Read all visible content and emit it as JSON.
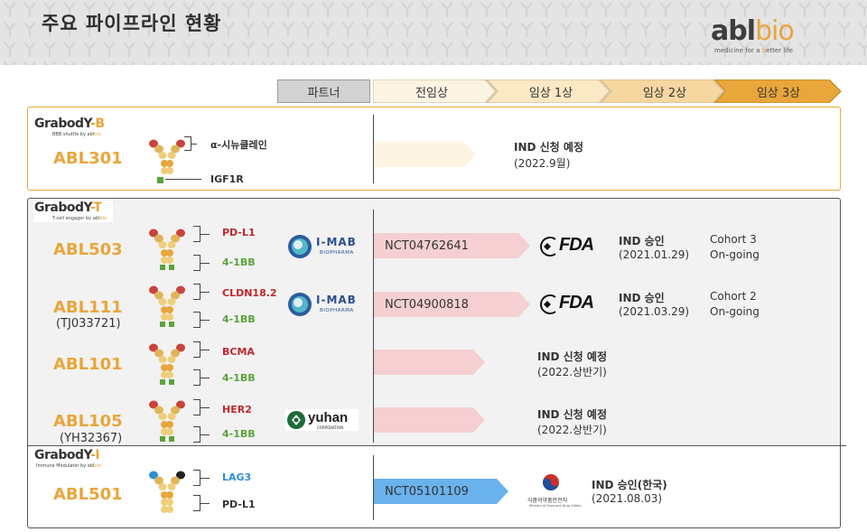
{
  "page": {
    "title": "주요 파이프라인 현황",
    "logo": {
      "main": "abl",
      "accent": "bio",
      "tagline_pre": "medicine for a ",
      "tagline_accent": "b",
      "tagline_post": "etter life"
    }
  },
  "stages": {
    "partner": "파트너",
    "items": [
      "전임상",
      "임상 1상",
      "임상 2상",
      "임상 3상"
    ]
  },
  "colors": {
    "accent": "#e8a63b",
    "preclinical": "#fdf4e3",
    "phase1": "#fbe8c4",
    "phase2": "#f6d7a0",
    "phase3": "#e8a63b",
    "pink_bar": "#f5cfd2",
    "blue_bar": "#6ab2ee"
  },
  "platforms": {
    "b": {
      "name": "Grabod",
      "y": "Y",
      "suffix": "-B",
      "sub": "BBB shuttle by ",
      "sub_brand_a": "abl",
      "sub_brand_b": "bio"
    },
    "t": {
      "name": "Grabod",
      "y": "Y",
      "suffix": "-T",
      "sub": "T-cell engager by ",
      "sub_brand_a": "abl",
      "sub_brand_b": "bio"
    },
    "i": {
      "name": "Grabod",
      "y": "Y",
      "suffix": "-I",
      "sub": "Immune Modulator by ",
      "sub_brand_a": "abl",
      "sub_brand_b": "bio"
    }
  },
  "programs": {
    "abl301": {
      "name": "ABL301",
      "target_top": "α-시뉴클레인",
      "target_bottom": "IGF1R",
      "status_main": "IND 신청 예정",
      "status_sub": "(2022.9월)"
    },
    "abl503": {
      "name": "ABL503",
      "target_top": "PD-L1",
      "target_bottom": "4-1BB",
      "partner": {
        "name": "I-MAB",
        "sub": "BIOPHARMA"
      },
      "trial": "NCT04762641",
      "regulator": "FDA",
      "status_main": "IND 승인",
      "status_sub": "(2021.01.29)",
      "cohort_line1": "Cohort 3",
      "cohort_line2": "On-going"
    },
    "abl111": {
      "name": "ABL111",
      "code": "(TJ033721)",
      "target_top": "CLDN18.2",
      "target_bottom": "4-1BB",
      "partner": {
        "name": "I-MAB",
        "sub": "BIOPHARMA"
      },
      "trial": "NCT04900818",
      "regulator": "FDA",
      "status_main": "IND 승인",
      "status_sub": "(2021.03.29)",
      "cohort_line1": "Cohort 2",
      "cohort_line2": "On-going"
    },
    "abl101": {
      "name": "ABL101",
      "target_top": "BCMA",
      "target_bottom": "4-1BB",
      "status_main": "IND 신청 예정",
      "status_sub": "(2022.상반기)"
    },
    "abl105": {
      "name": "ABL105",
      "code": "(YH32367)",
      "target_top": "HER2",
      "target_bottom": "4-1BB",
      "partner": {
        "name": "yuhan",
        "sub": "CORPORATION"
      },
      "status_main": "IND 신청 예정",
      "status_sub": "(2022.상반기)"
    },
    "abl501": {
      "name": "ABL501",
      "target_top": "LAG3",
      "target_bottom": "PD-L1",
      "trial": "NCT05101109",
      "regulator": {
        "name": "식품의약품안전처",
        "sub": "Ministry of Food and Drug Safety"
      },
      "status_main": "IND 승인(한국)",
      "status_sub": "(2021.08.03)"
    }
  }
}
